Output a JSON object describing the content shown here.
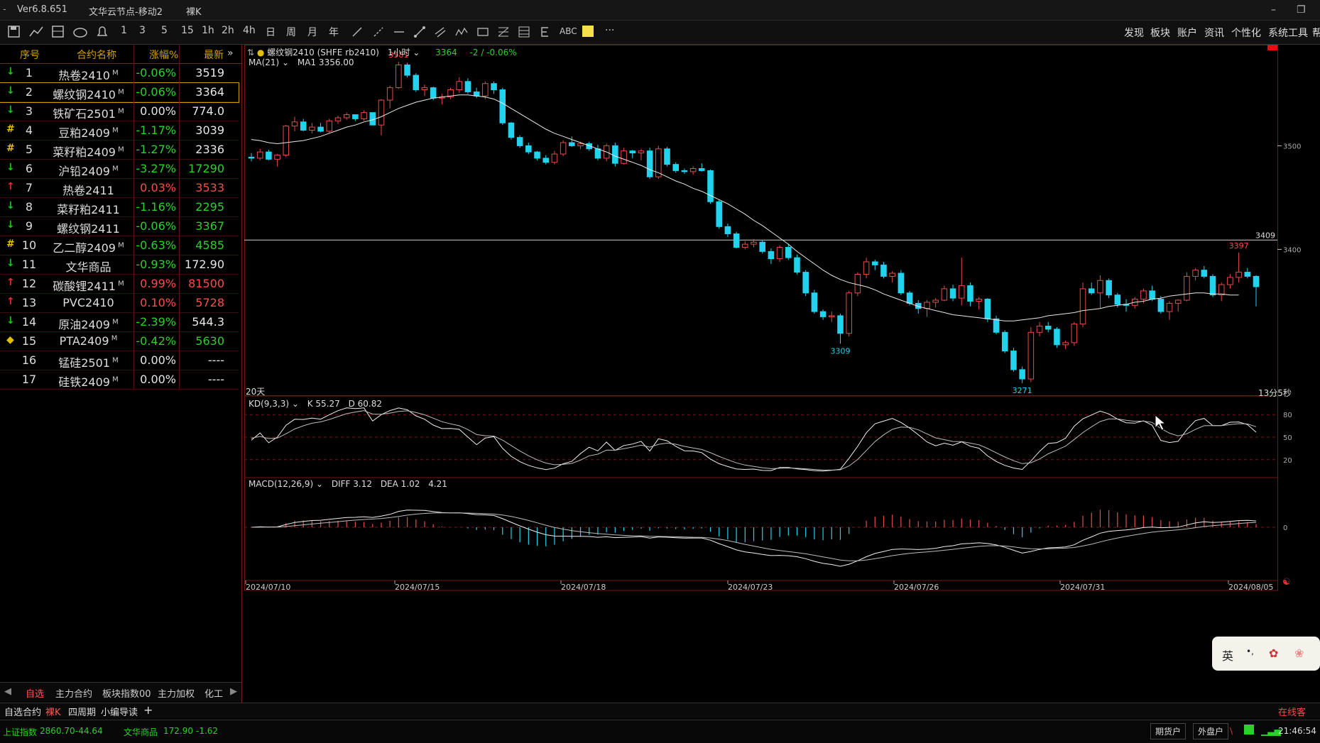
{
  "titlebar": {
    "version": "Ver6.8.651",
    "server": "文华云节点-移动2",
    "mode": "裸K"
  },
  "toolbar": {
    "period_items": [
      "1",
      "3",
      "5",
      "15",
      "1h",
      "2h",
      "4h",
      "日",
      "周",
      "月",
      "年"
    ],
    "abc_label": "ABC",
    "more_label": "···",
    "right_menu": [
      "发现",
      "板块",
      "账户",
      "资讯",
      "个性化",
      "系统工具",
      "帮"
    ]
  },
  "watchlist": {
    "headers": {
      "no": "序号",
      "name": "合约名称",
      "pct": "涨幅%",
      "last": "最新"
    },
    "rows": [
      {
        "no": "1",
        "name": "热卷2410",
        "sup": "M",
        "pct": "-0.06%",
        "last": "3519",
        "marker": "↓",
        "marker_color": "#1fc41f",
        "pct_color": "#2bd12b",
        "last_color": "#e6e6e6"
      },
      {
        "no": "2",
        "name": "螺纹钢2410",
        "sup": "M",
        "pct": "-0.06%",
        "last": "3364",
        "marker": "↓",
        "marker_color": "#1fc41f",
        "pct_color": "#2bd12b",
        "last_color": "#e6e6e6"
      },
      {
        "no": "3",
        "name": "铁矿石2501",
        "sup": "M",
        "pct": "0.00%",
        "last": "774.0",
        "marker": "↓",
        "marker_color": "#1fc41f",
        "pct_color": "#e6e6e6",
        "last_color": "#e6e6e6"
      },
      {
        "no": "4",
        "name": "豆粕2409",
        "sup": "M",
        "pct": "-1.17%",
        "last": "3039",
        "marker": "#",
        "marker_color": "#e0c000",
        "pct_color": "#2bd12b",
        "last_color": "#e6e6e6"
      },
      {
        "no": "5",
        "name": "菜籽粕2409",
        "sup": "M",
        "pct": "-1.27%",
        "last": "2336",
        "marker": "#",
        "marker_color": "#e0c000",
        "pct_color": "#2bd12b",
        "last_color": "#e6e6e6"
      },
      {
        "no": "6",
        "name": "沪铅2409",
        "sup": "M",
        "pct": "-3.27%",
        "last": "17290",
        "marker": "↓",
        "marker_color": "#1fc41f",
        "pct_color": "#2bd12b",
        "last_color": "#2bd12b"
      },
      {
        "no": "7",
        "name": "热卷2411",
        "sup": "",
        "pct": "0.03%",
        "last": "3533",
        "marker": "↑",
        "marker_color": "#e03030",
        "pct_color": "#ff4a4a",
        "last_color": "#ff4a4a"
      },
      {
        "no": "8",
        "name": "菜籽粕2411",
        "sup": "",
        "pct": "-1.16%",
        "last": "2295",
        "marker": "↓",
        "marker_color": "#1fc41f",
        "pct_color": "#2bd12b",
        "last_color": "#2bd12b"
      },
      {
        "no": "9",
        "name": "螺纹钢2411",
        "sup": "",
        "pct": "-0.06%",
        "last": "3367",
        "marker": "↓",
        "marker_color": "#1fc41f",
        "pct_color": "#2bd12b",
        "last_color": "#2bd12b"
      },
      {
        "no": "10",
        "name": "乙二醇2409",
        "sup": "M",
        "pct": "-0.63%",
        "last": "4585",
        "marker": "#",
        "marker_color": "#e0c000",
        "pct_color": "#2bd12b",
        "last_color": "#2bd12b"
      },
      {
        "no": "11",
        "name": "文华商品",
        "sup": "",
        "pct": "-0.93%",
        "last": "172.90",
        "marker": "↓",
        "marker_color": "#1fc41f",
        "pct_color": "#2bd12b",
        "last_color": "#e6e6e6"
      },
      {
        "no": "12",
        "name": "碳酸锂2411",
        "sup": "M",
        "pct": "0.99%",
        "last": "81500",
        "marker": "↑",
        "marker_color": "#e03030",
        "pct_color": "#ff4a4a",
        "last_color": "#ff4a4a"
      },
      {
        "no": "13",
        "name": "PVC2410",
        "sup": "",
        "pct": "0.10%",
        "last": "5728",
        "marker": "↑",
        "marker_color": "#e03030",
        "pct_color": "#ff4a4a",
        "last_color": "#ff4a4a"
      },
      {
        "no": "14",
        "name": "原油2409",
        "sup": "M",
        "pct": "-2.39%",
        "last": "544.3",
        "marker": "↓",
        "marker_color": "#1fc41f",
        "pct_color": "#2bd12b",
        "last_color": "#e6e6e6"
      },
      {
        "no": "15",
        "name": "PTA2409",
        "sup": "M",
        "pct": "-0.42%",
        "last": "5630",
        "marker": "◆",
        "marker_color": "#e0c000",
        "pct_color": "#2bd12b",
        "last_color": "#2bd12b"
      },
      {
        "no": "16",
        "name": "锰硅2501",
        "sup": "M",
        "pct": "0.00%",
        "last": "----",
        "marker": "",
        "marker_color": "#000",
        "pct_color": "#e6e6e6",
        "last_color": "#e6e6e6"
      },
      {
        "no": "17",
        "name": "硅铁2409",
        "sup": "M",
        "pct": "0.00%",
        "last": "----",
        "marker": "",
        "marker_color": "#000",
        "pct_color": "#e6e6e6",
        "last_color": "#e6e6e6"
      }
    ]
  },
  "side_tabs": [
    "自选",
    "主力合约",
    "板块指数00",
    "主力加权",
    "化工"
  ],
  "bottom_tabs": [
    "自选合约",
    "裸K",
    "四周期",
    "小编导读"
  ],
  "status": {
    "index1_name": "上证指数",
    "index1_value": "2860.70",
    "index1_change": "-44.64",
    "index2_name": "文华商品",
    "index2_value": "172.90",
    "index2_change": "-1.62",
    "acct1": "期货户",
    "acct2": "外盘户",
    "time": "21:46:54",
    "online": "在线客"
  },
  "chart": {
    "header": {
      "contract": "螺纹钢2410",
      "code": "(SHFE rb2410)",
      "period": "1小时",
      "price": "3364",
      "change": "-2 / -0.06%"
    },
    "ma_label": "MA(21)",
    "ma_value_label": "MA1 3356.00",
    "kd_label": "KD(9,3,3)",
    "kd_k": "K 55.27",
    "kd_d": "D 60.82",
    "macd_label": "MACD(12,26,9)",
    "macd_diff": "DIFF 3.12",
    "macd_dea": "DEA 1.02",
    "macd_val": "4.21",
    "period_note": "20天",
    "timer": "13分5秒",
    "marks": {
      "high": "3581",
      "low1": "3309",
      "low2": "3271",
      "high2": "3397",
      "hline": "3409"
    },
    "yticks": [
      "3500",
      "3400"
    ],
    "kd_ticks": [
      "80",
      "50",
      "20"
    ],
    "macd_tick": "0",
    "dates": [
      "2024/07/10",
      "2024/07/15",
      "2024/07/18",
      "2024/07/23",
      "2024/07/26",
      "2024/07/31",
      "2024/08/05"
    ],
    "ime_labels": {
      "lang": "英",
      "punct": "•,"
    }
  },
  "chart_data": {
    "type": "candlestick",
    "symbol": "螺纹钢2410",
    "x": [
      "2024/07/10",
      "2024/07/15",
      "2024/07/18",
      "2024/07/23",
      "2024/07/26",
      "2024/07/31",
      "2024/08/05"
    ],
    "candles_ohlc": [
      [
        3489,
        3493,
        3485,
        3488
      ],
      [
        3488,
        3497,
        3486,
        3494
      ],
      [
        3494,
        3496,
        3486,
        3487
      ],
      [
        3487,
        3492,
        3480,
        3491
      ],
      [
        3491,
        3520,
        3489,
        3519
      ],
      [
        3519,
        3528,
        3514,
        3523
      ],
      [
        3523,
        3526,
        3514,
        3515
      ],
      [
        3515,
        3522,
        3512,
        3518
      ],
      [
        3518,
        3522,
        3513,
        3514
      ],
      [
        3514,
        3526,
        3512,
        3524
      ],
      [
        3524,
        3529,
        3521,
        3527
      ],
      [
        3527,
        3532,
        3525,
        3530
      ],
      [
        3530,
        3530,
        3524,
        3526
      ],
      [
        3526,
        3534,
        3524,
        3532
      ],
      [
        3532,
        3532,
        3520,
        3520
      ],
      [
        3520,
        3545,
        3510,
        3544
      ],
      [
        3544,
        3558,
        3536,
        3556
      ],
      [
        3556,
        3581,
        3555,
        3578
      ],
      [
        3578,
        3580,
        3566,
        3568
      ],
      [
        3568,
        3570,
        3552,
        3554
      ],
      [
        3554,
        3559,
        3548,
        3556
      ],
      [
        3556,
        3557,
        3544,
        3546
      ],
      [
        3546,
        3550,
        3540,
        3547
      ],
      [
        3547,
        3556,
        3545,
        3554
      ],
      [
        3554,
        3566,
        3551,
        3562
      ],
      [
        3562,
        3565,
        3550,
        3552
      ],
      [
        3552,
        3556,
        3546,
        3548
      ],
      [
        3548,
        3562,
        3545,
        3560
      ],
      [
        3560,
        3562,
        3550,
        3554
      ],
      [
        3554,
        3556,
        3520,
        3522
      ],
      [
        3522,
        3523,
        3506,
        3508
      ],
      [
        3508,
        3510,
        3498,
        3500
      ],
      [
        3500,
        3503,
        3492,
        3494
      ],
      [
        3494,
        3495,
        3486,
        3488
      ],
      [
        3488,
        3491,
        3482,
        3484
      ],
      [
        3484,
        3495,
        3482,
        3492
      ],
      [
        3492,
        3505,
        3490,
        3503
      ],
      [
        3503,
        3509,
        3499,
        3500
      ],
      [
        3500,
        3504,
        3497,
        3502
      ],
      [
        3502,
        3504,
        3495,
        3497
      ],
      [
        3497,
        3501,
        3486,
        3488
      ],
      [
        3488,
        3502,
        3485,
        3500
      ],
      [
        3500,
        3503,
        3480,
        3483
      ],
      [
        3483,
        3498,
        3482,
        3495
      ],
      [
        3495,
        3496,
        3488,
        3493
      ],
      [
        3493,
        3497,
        3486,
        3495
      ],
      [
        3495,
        3498,
        3468,
        3470
      ],
      [
        3470,
        3500,
        3468,
        3497
      ],
      [
        3497,
        3499,
        3480,
        3482
      ],
      [
        3482,
        3484,
        3474,
        3476
      ],
      [
        3476,
        3478,
        3473,
        3475
      ],
      [
        3475,
        3480,
        3472,
        3478
      ],
      [
        3478,
        3483,
        3475,
        3476
      ],
      [
        3476,
        3477,
        3444,
        3446
      ],
      [
        3446,
        3448,
        3420,
        3422
      ],
      [
        3422,
        3425,
        3412,
        3415
      ],
      [
        3415,
        3417,
        3401,
        3402
      ],
      [
        3402,
        3408,
        3400,
        3405
      ],
      [
        3405,
        3410,
        3402,
        3407
      ],
      [
        3407,
        3409,
        3396,
        3398
      ],
      [
        3398,
        3401,
        3386,
        3391
      ],
      [
        3391,
        3404,
        3388,
        3402
      ],
      [
        3402,
        3405,
        3390,
        3392
      ],
      [
        3392,
        3395,
        3376,
        3378
      ],
      [
        3378,
        3380,
        3355,
        3358
      ],
      [
        3358,
        3361,
        3338,
        3340
      ],
      [
        3340,
        3342,
        3332,
        3335
      ],
      [
        3335,
        3340,
        3330,
        3336
      ],
      [
        3336,
        3338,
        3309,
        3319
      ],
      [
        3319,
        3360,
        3316,
        3358
      ],
      [
        3358,
        3378,
        3355,
        3376
      ],
      [
        3376,
        3392,
        3372,
        3388
      ],
      [
        3388,
        3390,
        3380,
        3385
      ],
      [
        3385,
        3388,
        3372,
        3374
      ],
      [
        3374,
        3379,
        3368,
        3377
      ],
      [
        3377,
        3380,
        3356,
        3358
      ],
      [
        3358,
        3360,
        3346,
        3348
      ],
      [
        3348,
        3351,
        3338,
        3343
      ],
      [
        3343,
        3351,
        3335,
        3349
      ],
      [
        3349,
        3353,
        3344,
        3351
      ],
      [
        3351,
        3365,
        3350,
        3362
      ],
      [
        3362,
        3366,
        3350,
        3353
      ],
      [
        3353,
        3392,
        3346,
        3365
      ],
      [
        3365,
        3368,
        3345,
        3350
      ],
      [
        3350,
        3354,
        3342,
        3352
      ],
      [
        3352,
        3353,
        3330,
        3333
      ],
      [
        3333,
        3336,
        3318,
        3320
      ],
      [
        3320,
        3322,
        3300,
        3302
      ],
      [
        3302,
        3305,
        3282,
        3284
      ],
      [
        3284,
        3287,
        3271,
        3275
      ],
      [
        3275,
        3325,
        3272,
        3320
      ],
      [
        3320,
        3330,
        3316,
        3326
      ],
      [
        3326,
        3330,
        3320,
        3323
      ],
      [
        3323,
        3325,
        3305,
        3308
      ],
      [
        3308,
        3312,
        3304,
        3310
      ],
      [
        3310,
        3330,
        3307,
        3328
      ],
      [
        3328,
        3368,
        3325,
        3362
      ],
      [
        3362,
        3368,
        3356,
        3358
      ],
      [
        3358,
        3375,
        3343,
        3370
      ],
      [
        3370,
        3372,
        3353,
        3356
      ],
      [
        3356,
        3358,
        3344,
        3347
      ],
      [
        3347,
        3352,
        3340,
        3346
      ],
      [
        3346,
        3354,
        3343,
        3352
      ],
      [
        3352,
        3362,
        3348,
        3360
      ],
      [
        3360,
        3365,
        3350,
        3352
      ],
      [
        3352,
        3355,
        3338,
        3340
      ],
      [
        3340,
        3350,
        3332,
        3348
      ],
      [
        3348,
        3352,
        3340,
        3351
      ],
      [
        3351,
        3378,
        3350,
        3374
      ],
      [
        3374,
        3382,
        3370,
        3380
      ],
      [
        3380,
        3384,
        3372,
        3374
      ],
      [
        3374,
        3376,
        3354,
        3356
      ],
      [
        3356,
        3368,
        3350,
        3366
      ],
      [
        3366,
        3376,
        3362,
        3373
      ],
      [
        3373,
        3397,
        3368,
        3378
      ],
      [
        3378,
        3382,
        3372,
        3374
      ],
      [
        3374,
        3375,
        3345,
        3364
      ]
    ],
    "ma21": [
      3506,
      3505,
      3503,
      3502,
      3503,
      3504,
      3505,
      3507,
      3509,
      3512,
      3515,
      3518,
      3520,
      3523,
      3525,
      3528,
      3532,
      3536,
      3539,
      3542,
      3544,
      3546,
      3547,
      3548,
      3549,
      3549,
      3548,
      3547,
      3545,
      3541,
      3536,
      3531,
      3526,
      3521,
      3516,
      3512,
      3509,
      3506,
      3503,
      3500,
      3497,
      3494,
      3490,
      3487,
      3484,
      3481,
      3477,
      3474,
      3470,
      3466,
      3463,
      3459,
      3456,
      3452,
      3448,
      3444,
      3439,
      3434,
      3428,
      3423,
      3417,
      3411,
      3405,
      3398,
      3392,
      3386,
      3380,
      3375,
      3371,
      3368,
      3366,
      3364,
      3361,
      3357,
      3354,
      3351,
      3348,
      3345,
      3343,
      3341,
      3339,
      3337,
      3336,
      3335,
      3334,
      3333,
      3332,
      3331,
      3331,
      3332,
      3333,
      3334,
      3336,
      3337,
      3338,
      3339,
      3341,
      3342,
      3343,
      3345,
      3346,
      3347,
      3349,
      3350,
      3352,
      3353,
      3355,
      3356,
      3357,
      3358,
      3358,
      3357,
      3357,
      3356,
      3356
    ],
    "kd": {
      "K": 55.27,
      "D": 60.82,
      "levels": [
        20,
        50,
        80
      ]
    },
    "macd": {
      "DIFF": 3.12,
      "DEA": 1.02,
      "MACD": 4.21
    },
    "y_labels": [
      "3500",
      "3400"
    ],
    "annotations": {
      "3581": "high",
      "3309": "low",
      "3271": "low",
      "3397": "high",
      "3409": "horizontal line"
    }
  }
}
